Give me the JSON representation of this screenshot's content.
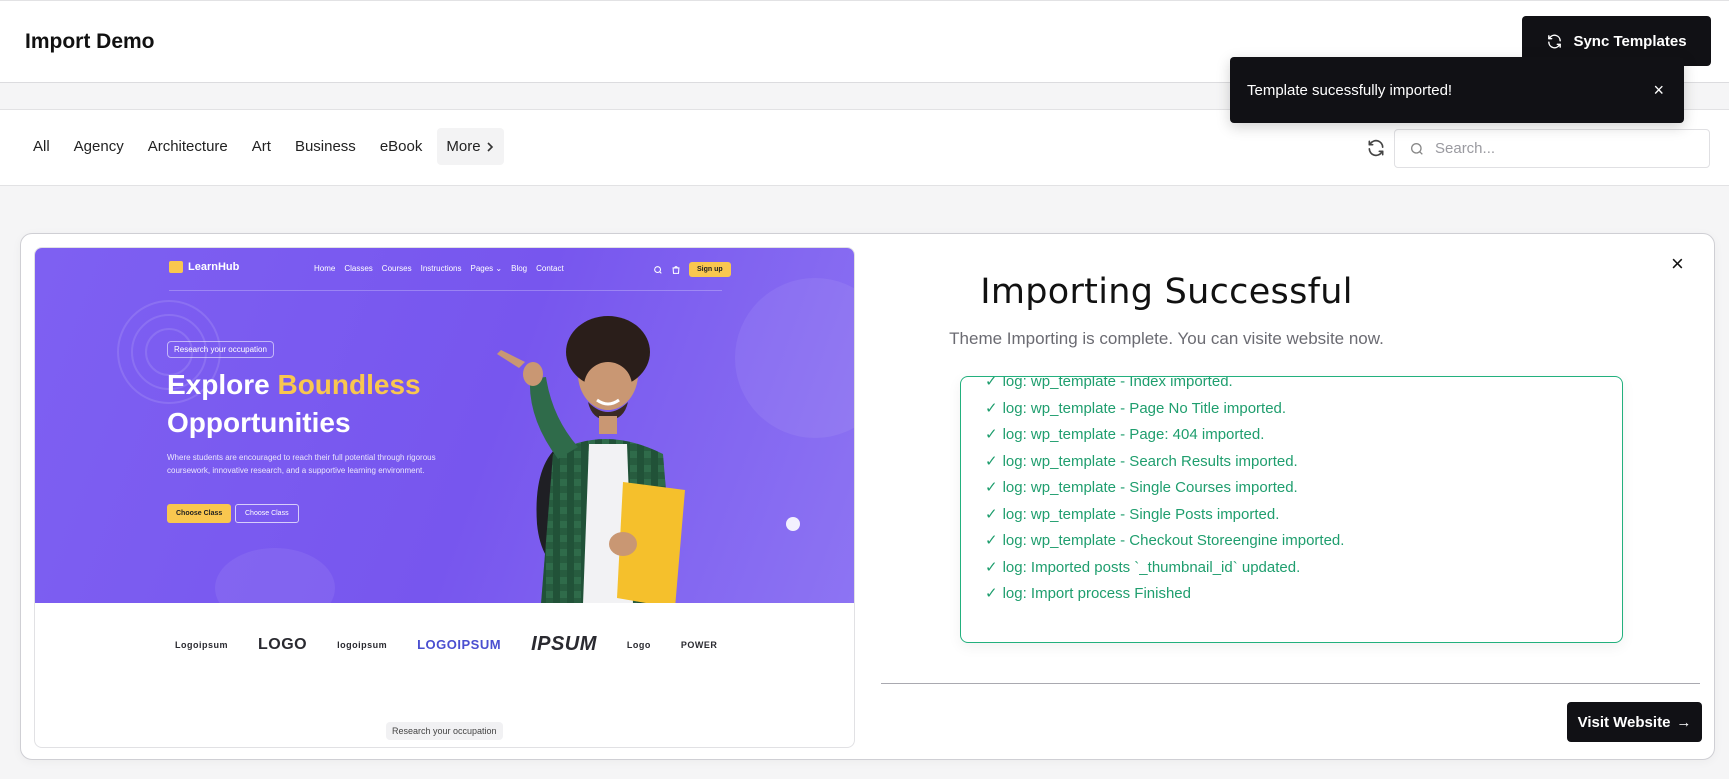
{
  "header": {
    "title": "Import Demo",
    "sync_label": "Sync Templates"
  },
  "toast": {
    "message": "Template sucessfully imported!",
    "close": "×"
  },
  "filters": {
    "tabs": [
      {
        "label": "All"
      },
      {
        "label": "Agency"
      },
      {
        "label": "Architecture"
      },
      {
        "label": "Art"
      },
      {
        "label": "Business"
      },
      {
        "label": "eBook"
      },
      {
        "label": "More"
      }
    ],
    "search_placeholder": "Search..."
  },
  "preview": {
    "logo": "LearnHub",
    "nav": [
      "Home",
      "Classes",
      "Courses",
      "Instructions",
      "Pages ⌄",
      "Blog",
      "Contact"
    ],
    "signup": "Sign up",
    "pill": "Research your occupation",
    "headline_part1": "Explore ",
    "headline_accent": "Boundless",
    "headline_part2": "Opportunities",
    "subtext": "Where students are encouraged to reach their full potential through rigorous coursework, innovative research, and a supportive learning environment.",
    "cta_primary": "Choose Class",
    "cta_secondary": "Choose Class",
    "brands": [
      "Logoipsum",
      "LOGO",
      "logoipsum",
      "LOGOIPSUM",
      "IPSUM",
      "Logo",
      "POWER"
    ],
    "research_tag": "Research your occupation"
  },
  "result": {
    "close": "×",
    "heading": "Importing Successful",
    "subtitle": "Theme Importing is complete. You can visite website now.",
    "logs": [
      "log: wp_template - Index imported.",
      "log: wp_template - Page No Title imported.",
      "log: wp_template - Page: 404 imported.",
      "log: wp_template - Search Results imported.",
      "log: wp_template - Single Courses imported.",
      "log: wp_template - Single Posts imported.",
      "log: wp_template - Checkout Storeengine imported.",
      "log: Imported posts `_thumbnail_id` updated.",
      "log: Import process Finished"
    ],
    "check": "✓",
    "visit_label": "Visit Website",
    "visit_arrow": "→"
  },
  "colors": {
    "dark": "#111115",
    "accent_green": "#1f9e6e",
    "hero_purple": "#7756ee",
    "hero_yellow": "#f9c74f"
  }
}
